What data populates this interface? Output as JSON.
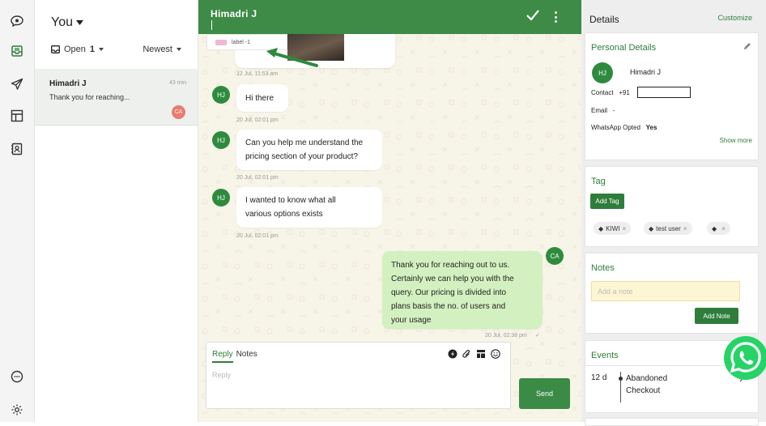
{
  "rail": {
    "icons": [
      "chat-bubble-icon",
      "inbox-icon",
      "send-icon",
      "layout-icon",
      "contacts-icon",
      "chat-outline-icon",
      "settings-icon"
    ]
  },
  "convlist": {
    "owner": "You",
    "filter_status": "Open",
    "filter_count": "1",
    "sort": "Newest",
    "conversation": {
      "name": "Himadri J",
      "time": "43 min",
      "preview": "Thank you for reaching...",
      "assignee": "CA"
    }
  },
  "chat": {
    "contact_name": "Himadri J",
    "label_chip": "label -1",
    "messages": [
      {
        "time": "12 Jul, 11:53 am"
      },
      {
        "avatar": "HJ",
        "text": "Hi there",
        "time": "20 Jul, 02:01 pm"
      },
      {
        "avatar": "HJ",
        "line1": "Can you help me understand the",
        "line2": "pricing section of your product?",
        "time": "20 Jul, 02:01 pm"
      },
      {
        "avatar": "HJ",
        "line1": "I wanted to know what all",
        "line2": "various options exists",
        "time": "20 Jul, 02:01 pm"
      },
      {
        "avatar": "CA",
        "line1": "Thank you for reaching out to us.",
        "line2": "Certainly we can help you with the",
        "line3": "query. Our pricing is divided into",
        "line4": "plans basis the no. of users and",
        "line5": "your usage",
        "time": "20 Jul, 02:38 pm"
      }
    ],
    "composer": {
      "tab_reply": "Reply",
      "tab_notes": "Notes",
      "placeholder": "Reply",
      "send_label": "Send"
    }
  },
  "details": {
    "title": "Details",
    "customize": "Customize",
    "personal": {
      "title": "Personal Details",
      "avatar": "HJ",
      "name": "Himadri J",
      "contact_label": "Contact",
      "contact_prefix": "+91",
      "email_label": "Email",
      "email_value": "-",
      "wa_label": "WhatsApp Opted",
      "wa_value": "Yes",
      "show_more": "Show more"
    },
    "tag": {
      "title": "Tag",
      "add_label": "Add Tag",
      "tags": [
        "KIWI",
        "test user",
        ""
      ]
    },
    "notes": {
      "title": "Notes",
      "placeholder": "Add a note",
      "add_label": "Add Note"
    },
    "events": {
      "title": "Events",
      "days": "12 d",
      "line1": "Abandoned",
      "line2": "Checkout"
    }
  },
  "colors": {
    "brand_green": "#3e8a47",
    "outgoing_bubble": "#d3f1c0",
    "chat_bg": "#f7f4e8",
    "whatsapp": "#25d366"
  }
}
